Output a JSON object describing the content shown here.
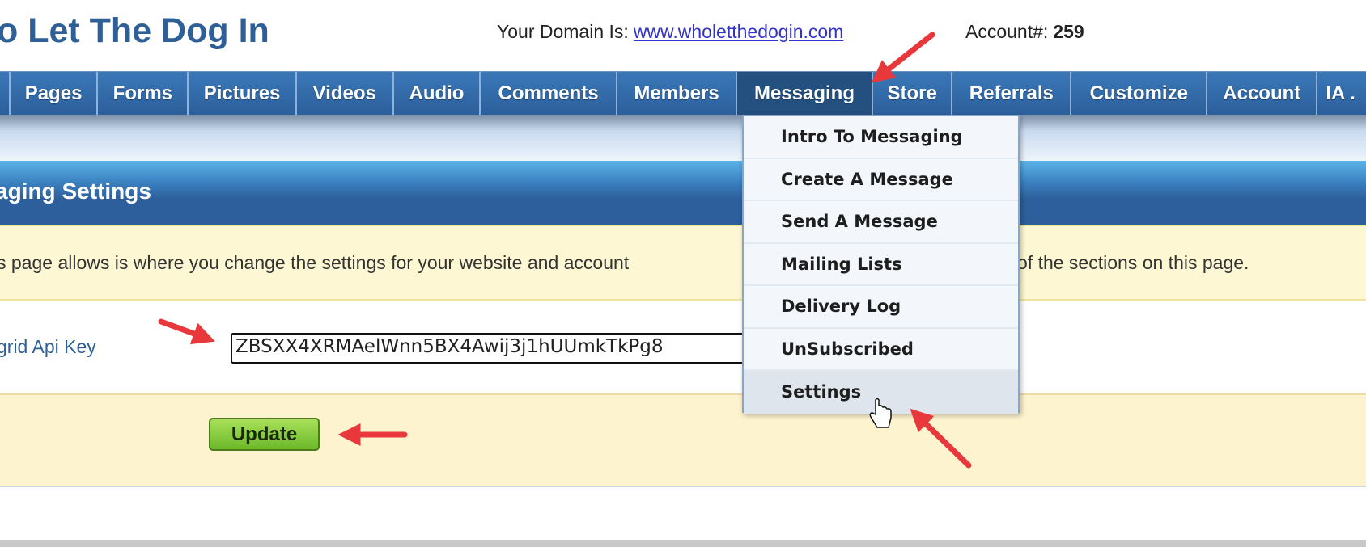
{
  "header": {
    "site_title": "o Let The Dog In",
    "domain_label": "Your Domain Is:",
    "domain_link": "www.wholetthedogin.com",
    "account_label": "Account#:",
    "account_number": "259"
  },
  "nav": {
    "tabs": [
      {
        "label": ""
      },
      {
        "label": "Pages"
      },
      {
        "label": "Forms"
      },
      {
        "label": "Pictures"
      },
      {
        "label": "Videos"
      },
      {
        "label": "Audio"
      },
      {
        "label": "Comments"
      },
      {
        "label": "Members"
      },
      {
        "label": "Messaging",
        "active": true
      },
      {
        "label": "Store"
      },
      {
        "label": "Referrals"
      },
      {
        "label": "Customize"
      },
      {
        "label": "Account"
      },
      {
        "label": "IA ."
      }
    ]
  },
  "dropdown": {
    "items": [
      {
        "label": "Intro To Messaging"
      },
      {
        "label": "Create A Message"
      },
      {
        "label": "Send A Message"
      },
      {
        "label": "Mailing Lists"
      },
      {
        "label": "Delivery Log"
      },
      {
        "label": "UnSubscribed"
      },
      {
        "label": "Settings",
        "hovered": true
      }
    ]
  },
  "page": {
    "heading": "aging Settings",
    "notice_left": "s page allows is where you change the settings for your website and account",
    "notice_right": "of the sections on this page.",
    "api_key_label": "grid Api Key",
    "api_key_value": "ZBSXX4XRMAelWnn5BX4Awij3j1hUUmkTkPg8",
    "update_label": "Update"
  },
  "colors": {
    "nav": "#2c5f9b",
    "annotation_arrow": "#e8383b",
    "update_button": "#8ccb3f",
    "notice_bg": "#fdf8d3"
  }
}
